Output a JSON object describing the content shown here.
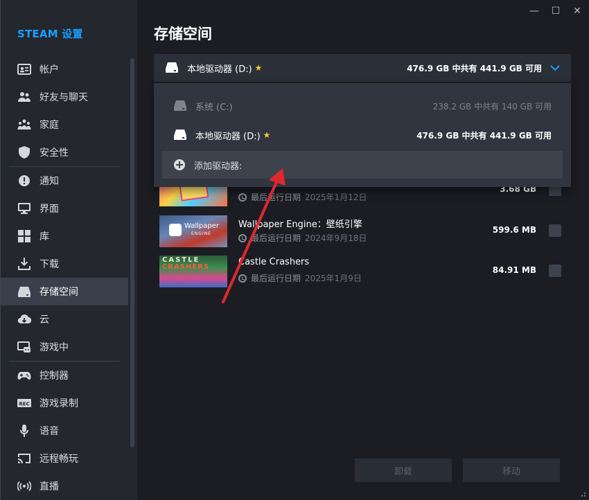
{
  "sidebar": {
    "brand": "STEAM 设置",
    "items": [
      {
        "label": "帐户",
        "icon": "account-card-icon"
      },
      {
        "label": "好友与聊天",
        "icon": "friends-icon"
      },
      {
        "label": "家庭",
        "icon": "family-icon"
      },
      {
        "label": "安全性",
        "icon": "shield-icon"
      },
      {
        "label": "通知",
        "icon": "notification-icon"
      },
      {
        "label": "界面",
        "icon": "monitor-icon"
      },
      {
        "label": "库",
        "icon": "grid-icon"
      },
      {
        "label": "下载",
        "icon": "download-icon"
      },
      {
        "label": "存储空间",
        "icon": "drive-icon"
      },
      {
        "label": "云",
        "icon": "cloud-icon"
      },
      {
        "label": "游戏中",
        "icon": "in-game-icon"
      },
      {
        "label": "控制器",
        "icon": "gamepad-icon"
      },
      {
        "label": "游戏录制",
        "icon": "rec-icon"
      },
      {
        "label": "语音",
        "icon": "microphone-icon"
      },
      {
        "label": "远程畅玩",
        "icon": "cast-icon"
      },
      {
        "label": "直播",
        "icon": "broadcast-icon"
      }
    ],
    "active": "存储空间"
  },
  "window": {
    "minimize": "—",
    "maximize": "☐",
    "close": "✕"
  },
  "main": {
    "title": "存储空间",
    "selected_drive": {
      "label": "本地驱动器 (D:)",
      "info": "476.9 GB 中共有 441.9 GB 可用"
    },
    "dropdown": {
      "items": [
        {
          "label": "系统 (C:)",
          "info": "238.2 GB 中共有 140 GB 可用"
        },
        {
          "label": "本地驱动器 (D:)",
          "info": "476.9 GB 中共有 441.9 GB 可用"
        }
      ],
      "add_label": "添加驱动器:"
    },
    "games": [
      {
        "name": "",
        "date_label": "最后运行日期",
        "date": "2025年1月12日",
        "size": "3.68 GB"
      },
      {
        "name": "Wallpaper Engine：壁纸引擎",
        "date_label": "最后运行日期",
        "date": "2024年9月18日",
        "size": "599.6 MB"
      },
      {
        "name": "Castle Crashers",
        "date_label": "最后运行日期",
        "date": "2025年1月9日",
        "size": "84.91 MB"
      }
    ],
    "thumb_text": {
      "wallpaper_line1": "Wallpaper",
      "wallpaper_line2": "ENGINE",
      "castle_line1": "CASTLE",
      "castle_line2": "CRASHERS"
    },
    "buttons": {
      "uninstall": "卸载",
      "move": "移动"
    }
  },
  "colors": {
    "accent": "#1a9fff",
    "star": "#ffc82c",
    "annotation_arrow": "#e0282e"
  }
}
